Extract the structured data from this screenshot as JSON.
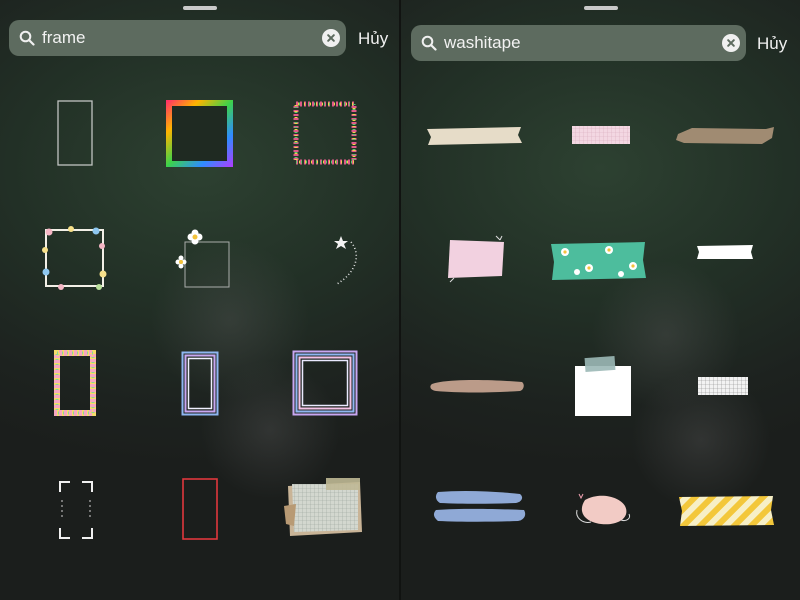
{
  "left_panel": {
    "search": {
      "query": "frame",
      "icon": "search-icon",
      "clear_icon": "clear-icon"
    },
    "cancel_label": "Hủy",
    "stickers": [
      "thin-white-frame",
      "rainbow-square-frame",
      "confetti-dots-frame",
      "flower-border-frame",
      "daisy-square-frame",
      "star-swirl-frame",
      "multicolor-dotted-frame",
      "pastel-stripe-portrait-frame",
      "pastel-stripe-square-frame",
      "black-white-corner-frame",
      "thin-red-frame",
      "grid-paper-scrap-frame"
    ]
  },
  "right_panel": {
    "search": {
      "query": "washitape",
      "icon": "search-icon",
      "clear_icon": "clear-icon"
    },
    "cancel_label": "Hủy",
    "stickers": [
      "beige-tape",
      "pink-grid-tape",
      "brown-tape",
      "pink-note",
      "teal-daisy-tape",
      "white-tape",
      "tan-brush-tape",
      "taped-note-paper",
      "white-grid-tape",
      "blue-brush-tape",
      "pink-blob",
      "yellow-stripe-tape"
    ]
  },
  "colors": {
    "panel_bg": "#223026",
    "search_bg": "#5d6b5f",
    "text": "#f2f2f2"
  }
}
